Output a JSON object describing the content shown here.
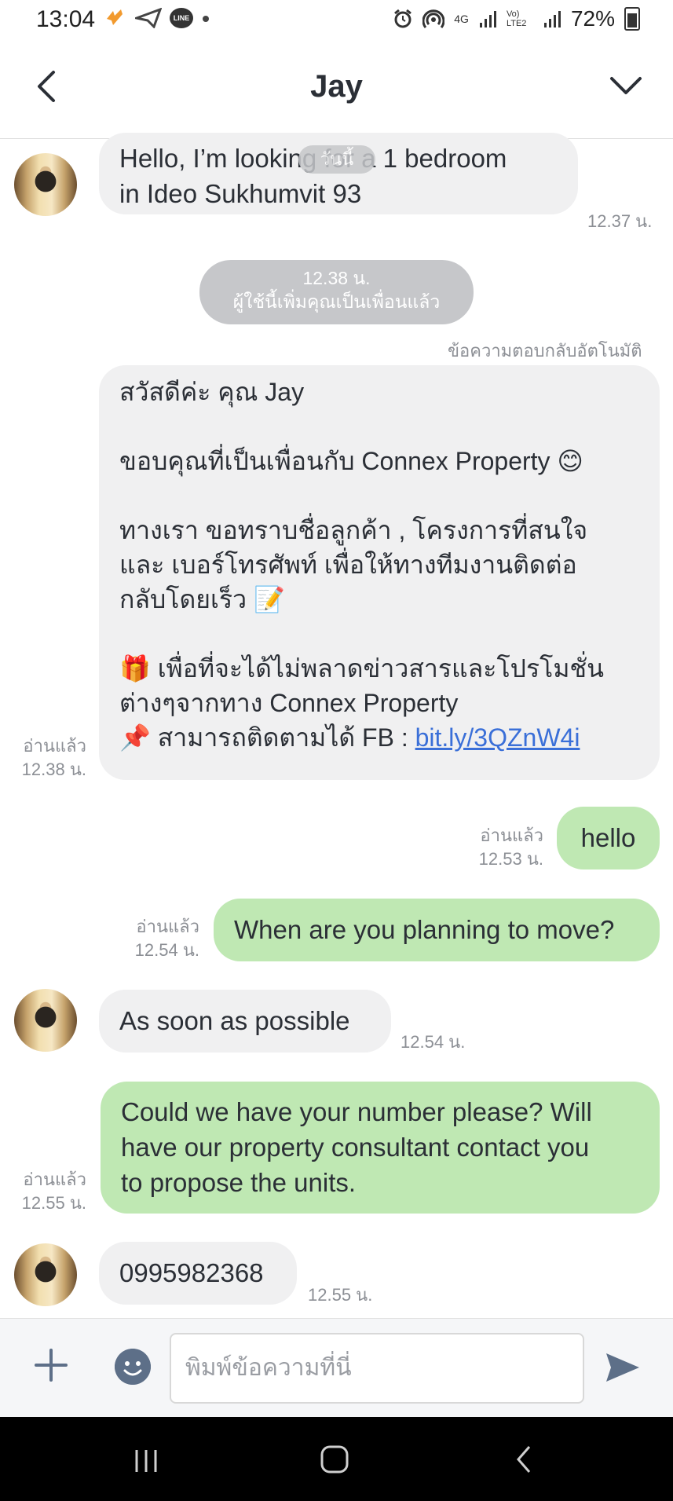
{
  "status_bar": {
    "time": "13:04",
    "network_4g": "4G",
    "volte": "Vo) LTE2",
    "battery": "72%"
  },
  "header": {
    "title": "Jay"
  },
  "messages": {
    "date_chip": "วันนี้",
    "m1": {
      "line1": "Hello, I’m looking for a 1 bedroom",
      "line2": "in Ideo Sukhumvit 93",
      "time": "12.37 น."
    },
    "system": {
      "line1": "12.38 น.",
      "line2": "ผู้ใช้นี้เพิ่มคุณเป็นเพื่อนแล้ว"
    },
    "auto_reply_label": "ข้อความตอบกลับอัตโนมัติ",
    "m2": {
      "greeting": "สวัสดีค่ะ คุณ Jay",
      "thanks": "ขอบคุณที่เป็นเพื่อนกับ Connex Property 😊",
      "ask1": "ทางเรา ขอทราบชื่อลูกค้า , โครงการที่สนใจ",
      "ask2": "และ เบอร์โทรศัพท์ เพื่อให้ทางทีมงานติดต่อ",
      "ask3": "กลับโดยเร็ว 📝",
      "promo1": "🎁 เพื่อที่จะได้ไม่พลาดข่าวสารและโปรโมชั่น",
      "promo2": "ต่างๆจากทาง Connex Property",
      "follow": "📌 สามารถติดตามได้ FB : ",
      "link": "bit.ly/3QZnW4i",
      "read": "อ่านแล้ว",
      "time": "12.38 น."
    },
    "m3": {
      "text": "hello",
      "read": "อ่านแล้ว",
      "time": "12.53 น."
    },
    "m4": {
      "text": "When are you planning to move?",
      "read": "อ่านแล้ว",
      "time": "12.54 น."
    },
    "m5": {
      "text": "As soon as possible",
      "time": "12.54 น."
    },
    "m6": {
      "line1": "Could we have your number please? Will",
      "line2": "have our property consultant contact you",
      "line3": "to propose the units.",
      "read": "อ่านแล้ว",
      "time": "12.55 น."
    },
    "m7": {
      "text": "0995982368",
      "time": "12.55 น."
    }
  },
  "composer": {
    "placeholder": "พิมพ์ข้อความที่นี่"
  },
  "colors": {
    "incoming_bubble": "#f0f0f1",
    "outgoing_bubble": "#bfe8b3",
    "link": "#3a6fd8"
  }
}
